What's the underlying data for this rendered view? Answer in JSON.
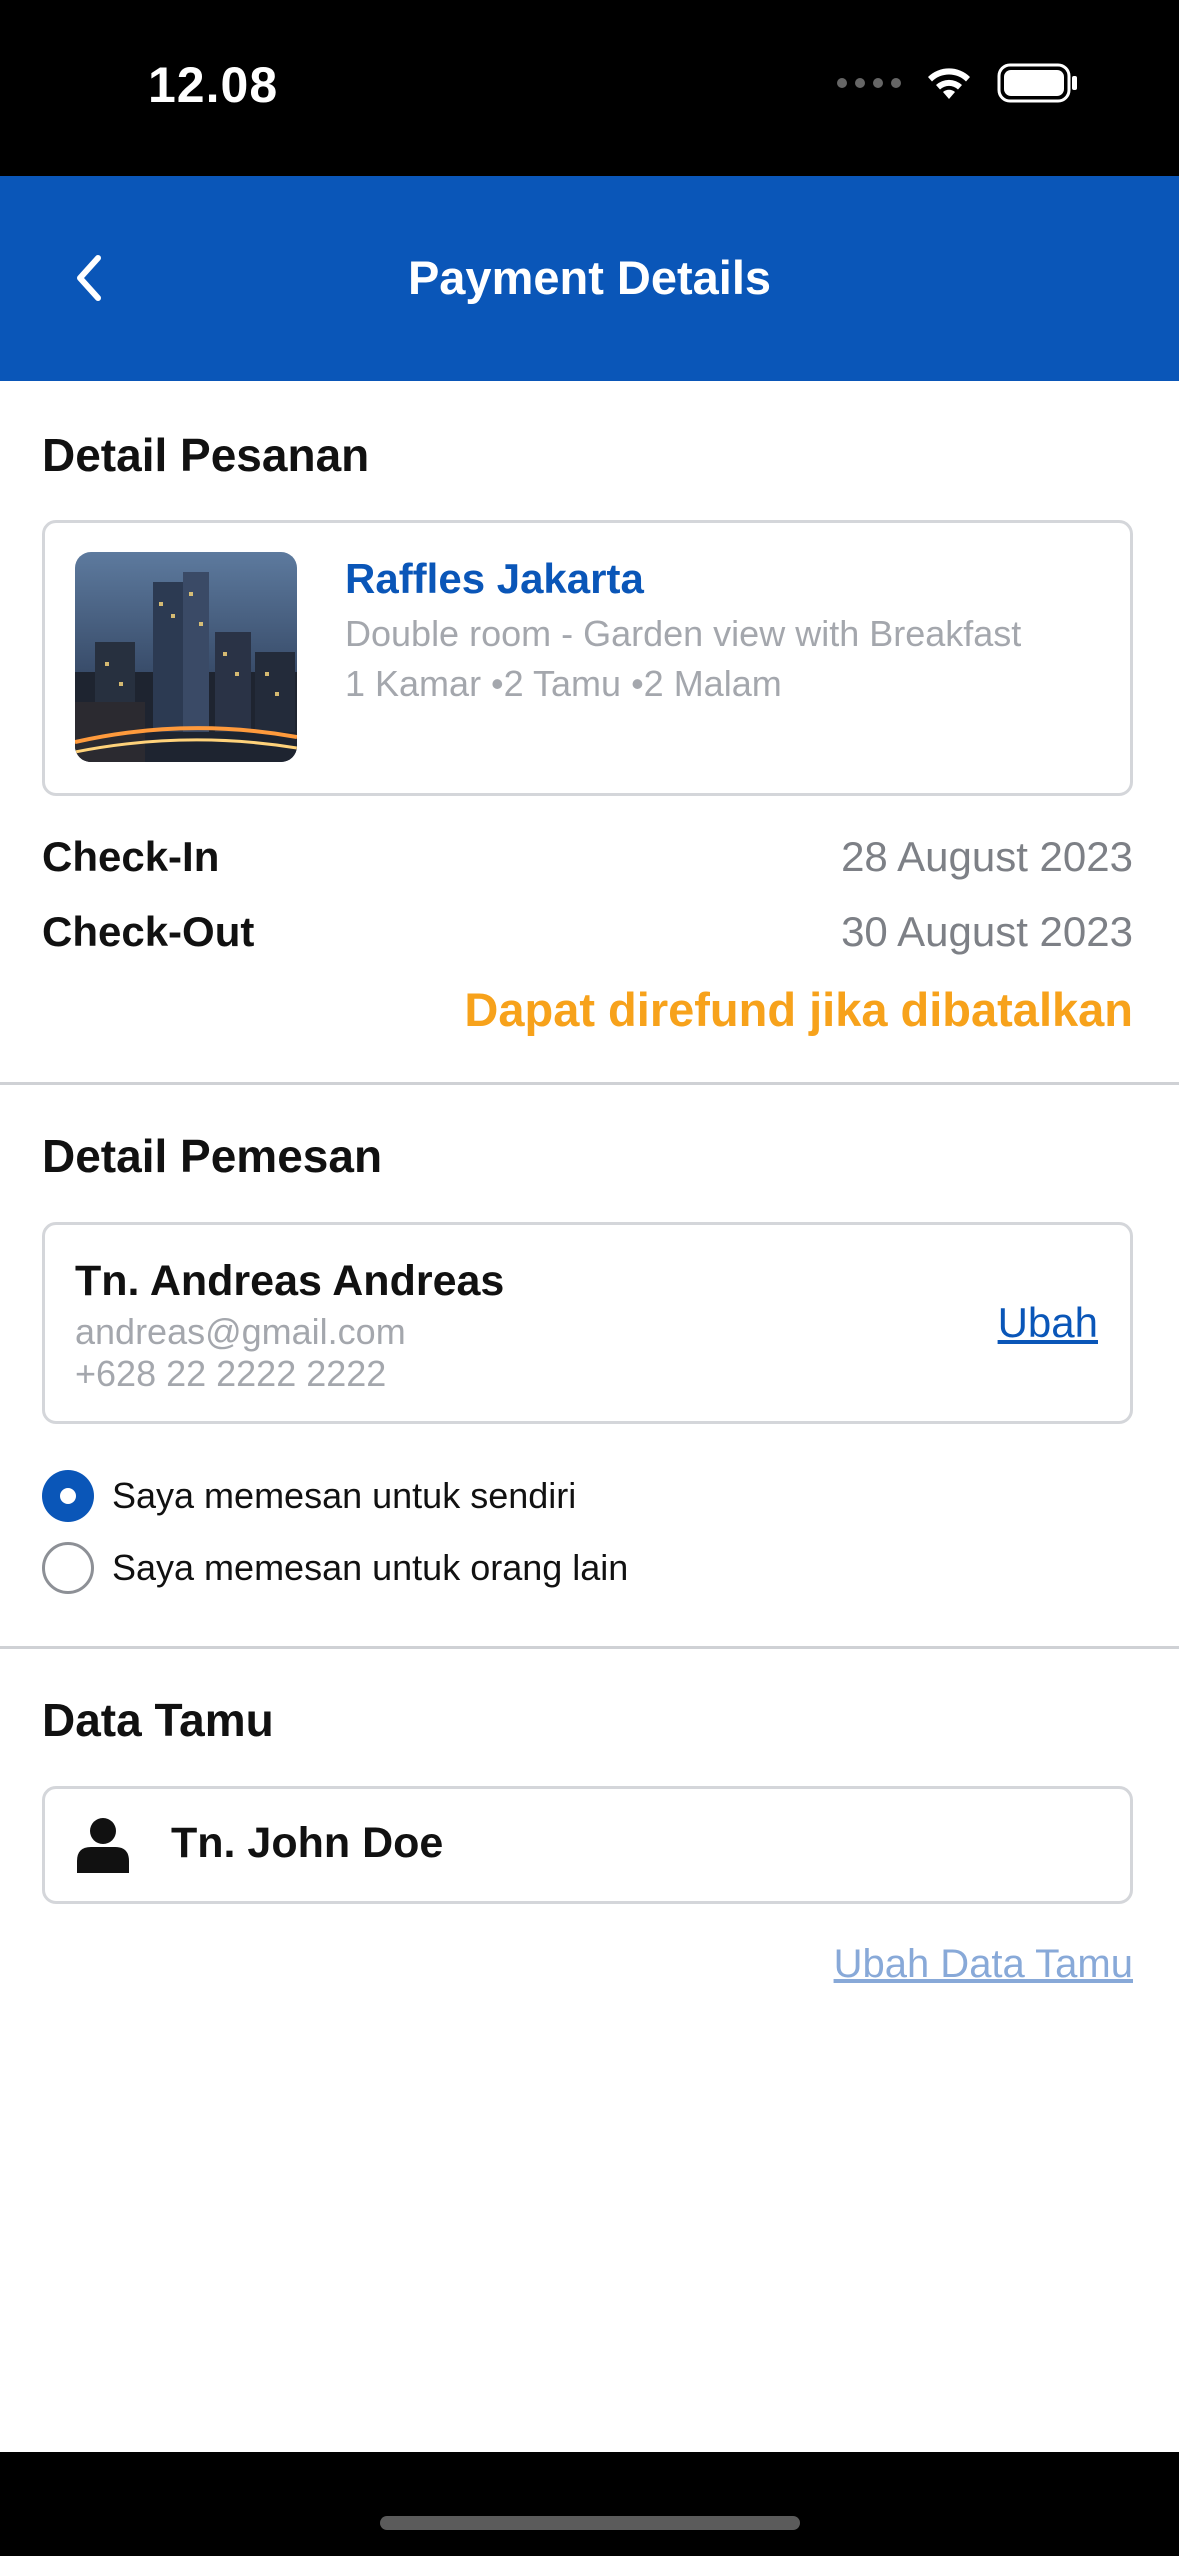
{
  "status_bar": {
    "time": "12.08"
  },
  "header": {
    "title": "Payment Details"
  },
  "order_detail": {
    "section_title": "Detail Pesanan",
    "hotel": {
      "name": "Raffles Jakarta",
      "room": "Double room - Garden view with Breakfast",
      "meta": "1 Kamar •2 Tamu •2 Malam"
    },
    "check_in": {
      "label": "Check-In",
      "value": "28 August 2023"
    },
    "check_out": {
      "label": "Check-Out",
      "value": "30 August 2023"
    },
    "refund_note": "Dapat direfund jika dibatalkan",
    "colors": {
      "refund": "#F7A21B",
      "accent": "#0A56B8"
    }
  },
  "booker_detail": {
    "section_title": "Detail Pemesan",
    "name": "Tn. Andreas Andreas",
    "email": "andreas@gmail.com",
    "phone": "+628 22 2222 2222",
    "edit_label": "Ubah",
    "options": [
      {
        "label": "Saya memesan untuk sendiri",
        "checked": true
      },
      {
        "label": "Saya memesan untuk orang lain",
        "checked": false
      }
    ]
  },
  "guest_data": {
    "section_title": "Data Tamu",
    "guest_name": "Tn. John Doe",
    "guest_icon": "person-icon",
    "edit_label": "Ubah Data Tamu"
  }
}
